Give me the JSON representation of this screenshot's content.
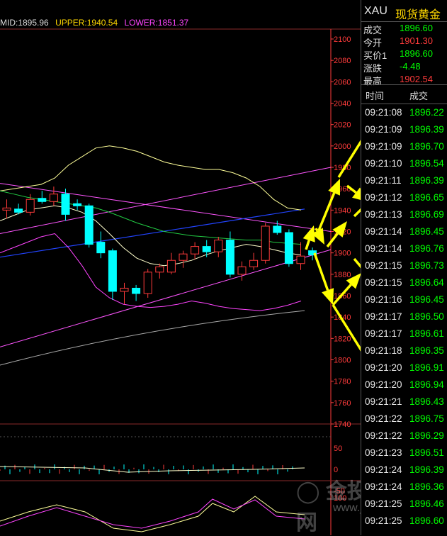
{
  "indicator_legend": {
    "mid": "MID:1895.96",
    "upper": "UPPER:1940.54",
    "lower": "LOWER:1851.37"
  },
  "quote": {
    "symbol": "XAU",
    "name": "现货黄金",
    "rows": [
      {
        "label": "成交",
        "value": "1896.60",
        "color": "green"
      },
      {
        "label": "今开",
        "value": "1901.30",
        "color": "red"
      },
      {
        "label": "买价1",
        "value": "1896.60",
        "color": "green"
      },
      {
        "label": "涨跌",
        "value": "-4.48",
        "color": "green"
      },
      {
        "label": "最高",
        "value": "1902.54",
        "color": "red"
      }
    ]
  },
  "ticks": {
    "header_time": "时间",
    "header_price": "成交",
    "rows": [
      {
        "time": "09:21:08",
        "price": "1896.22"
      },
      {
        "time": "09:21:09",
        "price": "1896.39"
      },
      {
        "time": "09:21:09",
        "price": "1896.70"
      },
      {
        "time": "09:21:10",
        "price": "1896.54"
      },
      {
        "time": "09:21:11",
        "price": "1896.39"
      },
      {
        "time": "09:21:12",
        "price": "1896.65"
      },
      {
        "time": "09:21:13",
        "price": "1896.69"
      },
      {
        "time": "09:21:14",
        "price": "1896.45"
      },
      {
        "time": "09:21:14",
        "price": "1896.76"
      },
      {
        "time": "09:21:15",
        "price": "1896.73"
      },
      {
        "time": "09:21:15",
        "price": "1896.64"
      },
      {
        "time": "09:21:16",
        "price": "1896.45"
      },
      {
        "time": "09:21:17",
        "price": "1896.50"
      },
      {
        "time": "09:21:17",
        "price": "1896.61"
      },
      {
        "time": "09:21:18",
        "price": "1896.35"
      },
      {
        "time": "09:21:20",
        "price": "1896.91"
      },
      {
        "time": "09:21:20",
        "price": "1896.94"
      },
      {
        "time": "09:21:21",
        "price": "1896.43"
      },
      {
        "time": "09:21:22",
        "price": "1896.75"
      },
      {
        "time": "09:21:22",
        "price": "1896.29"
      },
      {
        "time": "09:21:23",
        "price": "1896.51"
      },
      {
        "time": "09:21:24",
        "price": "1896.39"
      },
      {
        "time": "09:21:24",
        "price": "1896.36"
      },
      {
        "time": "09:21:25",
        "price": "1896.46"
      },
      {
        "time": "09:21:25",
        "price": "1896.60"
      }
    ]
  },
  "watermark": {
    "brand": "金投网",
    "url": "www.jrwel.com"
  },
  "colors": {
    "up": "#ff3b3b",
    "down": "#00ffff",
    "axis": "#ff3b3b",
    "upper_band": "#ffff99",
    "lower_band": "#ff44ff",
    "ma_blue": "#2244ff",
    "ma_green": "#22cc44",
    "ma_gray": "#aaaaaa",
    "trendline": "#ff55ff",
    "arrow": "#ffff00"
  },
  "chart_data": {
    "type": "candlestick",
    "ylim": [
      1740,
      2100
    ],
    "y_ticks": [
      2100,
      2080,
      2060,
      2040,
      2020,
      2000,
      1980,
      1960,
      1940,
      1920,
      1900,
      1880,
      1860,
      1840,
      1820,
      1800,
      1780,
      1760,
      1740
    ],
    "candles": [
      {
        "o": 1940,
        "h": 1950,
        "l": 1932,
        "c": 1942
      },
      {
        "o": 1941,
        "h": 1946,
        "l": 1936,
        "c": 1938
      },
      {
        "o": 1938,
        "h": 1955,
        "l": 1935,
        "c": 1950
      },
      {
        "o": 1951,
        "h": 1958,
        "l": 1946,
        "c": 1948
      },
      {
        "o": 1948,
        "h": 1962,
        "l": 1944,
        "c": 1955
      },
      {
        "o": 1955,
        "h": 1960,
        "l": 1930,
        "c": 1936
      },
      {
        "o": 1946,
        "h": 1950,
        "l": 1940,
        "c": 1944
      },
      {
        "o": 1944,
        "h": 1946,
        "l": 1905,
        "c": 1908
      },
      {
        "o": 1910,
        "h": 1920,
        "l": 1895,
        "c": 1900
      },
      {
        "o": 1902,
        "h": 1904,
        "l": 1856,
        "c": 1864
      },
      {
        "o": 1864,
        "h": 1872,
        "l": 1852,
        "c": 1867
      },
      {
        "o": 1867,
        "h": 1870,
        "l": 1855,
        "c": 1862
      },
      {
        "o": 1862,
        "h": 1885,
        "l": 1858,
        "c": 1882
      },
      {
        "o": 1882,
        "h": 1890,
        "l": 1876,
        "c": 1887
      },
      {
        "o": 1882,
        "h": 1900,
        "l": 1880,
        "c": 1893
      },
      {
        "o": 1893,
        "h": 1902,
        "l": 1886,
        "c": 1899
      },
      {
        "o": 1899,
        "h": 1910,
        "l": 1894,
        "c": 1906
      },
      {
        "o": 1906,
        "h": 1912,
        "l": 1896,
        "c": 1901
      },
      {
        "o": 1901,
        "h": 1915,
        "l": 1896,
        "c": 1912
      },
      {
        "o": 1912,
        "h": 1920,
        "l": 1877,
        "c": 1880
      },
      {
        "o": 1880,
        "h": 1892,
        "l": 1874,
        "c": 1887
      },
      {
        "o": 1887,
        "h": 1900,
        "l": 1884,
        "c": 1893
      },
      {
        "o": 1893,
        "h": 1928,
        "l": 1890,
        "c": 1925
      },
      {
        "o": 1925,
        "h": 1930,
        "l": 1917,
        "c": 1919
      },
      {
        "o": 1919,
        "h": 1922,
        "l": 1887,
        "c": 1890
      },
      {
        "o": 1890,
        "h": 1910,
        "l": 1884,
        "c": 1897
      },
      {
        "o": 1902,
        "h": 1905,
        "l": 1893,
        "c": 1898
      }
    ],
    "series": [
      {
        "name": "UPPER",
        "values": [
          1958,
          1960,
          1962,
          1964,
          1970,
          1982,
          1990,
          1998,
          2000,
          1998,
          1995,
          1990,
          1985,
          1982,
          1980,
          1978,
          1978,
          1975,
          1970,
          1962,
          1950,
          1942,
          1940
        ]
      },
      {
        "name": "MID",
        "values": [
          1930,
          1935,
          1940,
          1942,
          1944,
          1942,
          1938,
          1930,
          1918,
          1905,
          1895,
          1890,
          1888,
          1890,
          1893,
          1898,
          1902,
          1905,
          1908,
          1906,
          1903,
          1900,
          1898
        ]
      },
      {
        "name": "LOWER",
        "values": [
          1900,
          1905,
          1910,
          1915,
          1918,
          1905,
          1888,
          1868,
          1858,
          1852,
          1850,
          1849,
          1850,
          1852,
          1855,
          1853,
          1850,
          1848,
          1847,
          1846,
          1848,
          1851,
          1855
        ]
      }
    ],
    "osc1": {
      "ylim": [
        -60,
        60
      ],
      "ticks": [
        50,
        0,
        -50
      ]
    },
    "osc2": {
      "ylim": [
        80,
        120
      ],
      "ticks": [
        100
      ]
    }
  }
}
